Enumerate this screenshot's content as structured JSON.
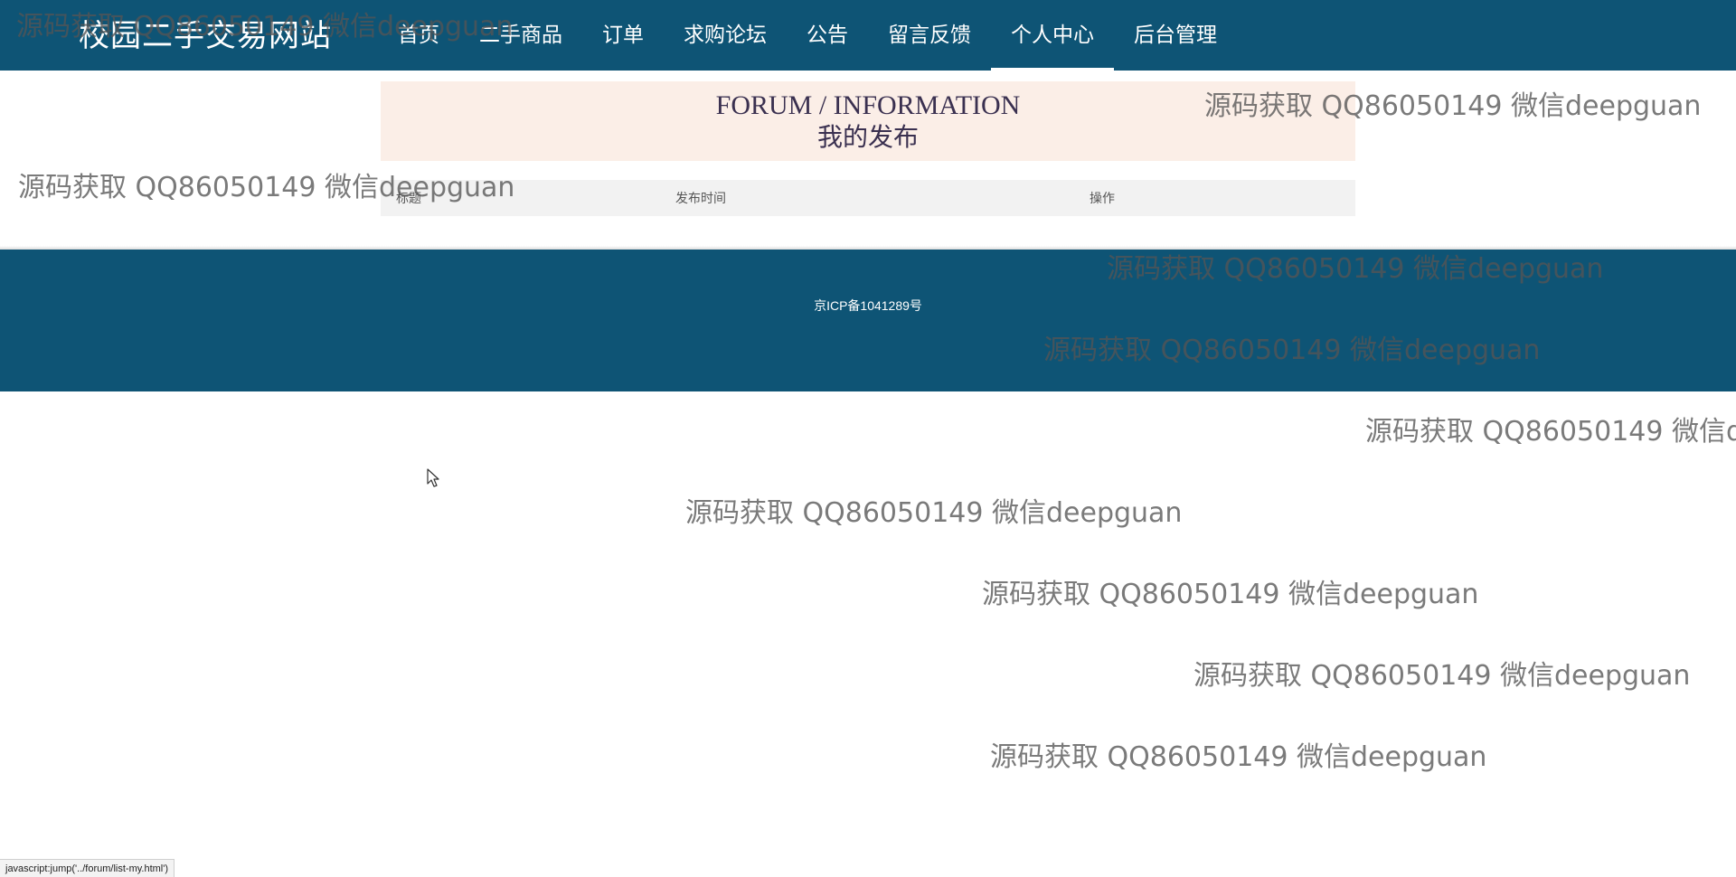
{
  "site": {
    "title": "校园二手交易网站"
  },
  "nav": {
    "items": [
      {
        "label": "首页"
      },
      {
        "label": "二手商品"
      },
      {
        "label": "订单"
      },
      {
        "label": "求购论坛"
      },
      {
        "label": "公告"
      },
      {
        "label": "留言反馈"
      },
      {
        "label": "个人中心",
        "active": true
      },
      {
        "label": "后台管理"
      }
    ]
  },
  "banner": {
    "title_en": "FORUM / INFORMATION",
    "title_cn": "我的发布"
  },
  "table": {
    "headers": [
      "标题",
      "发布时间",
      "操作"
    ]
  },
  "footer": {
    "icp": "京ICP备1041289号"
  },
  "watermark": {
    "text": "源码获取 QQ86050149 微信deepguan"
  },
  "statusbar": {
    "url": "javascript:jump('../forum/list-my.html')"
  },
  "colors": {
    "header_bg": "#0e5475",
    "banner_bg": "#fbeee7",
    "table_header_bg": "#f2f2f2"
  }
}
